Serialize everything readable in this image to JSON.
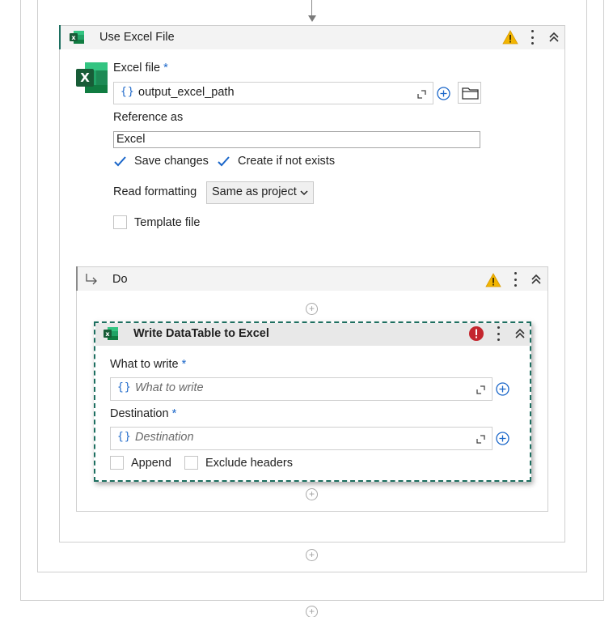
{
  "use_excel_file": {
    "title": "Use Excel File",
    "excel_file_label": "Excel file",
    "required_mark": "*",
    "excel_file_value": "output_excel_path",
    "braces": "{}",
    "reference_as_label": "Reference as",
    "reference_as_value": "Excel",
    "save_changes_label": "Save changes",
    "save_changes_checked": true,
    "create_if_not_exists_label": "Create if not exists",
    "create_if_not_exists_checked": true,
    "read_formatting_label": "Read formatting",
    "read_formatting_value": "Same as project",
    "template_file_label": "Template file",
    "template_file_checked": false
  },
  "do_block": {
    "title": "Do"
  },
  "write_datatable": {
    "title": "Write DataTable to Excel",
    "what_to_write_label": "What to write",
    "what_to_write_placeholder": "What to write",
    "destination_label": "Destination",
    "destination_placeholder": "Destination",
    "required_mark": "*",
    "braces": "{}",
    "append_label": "Append",
    "append_checked": false,
    "exclude_headers_label": "Exclude headers",
    "exclude_headers_checked": false
  },
  "colors": {
    "excel_green": "#1d7044",
    "accent_blue": "#1a66c9",
    "warning": "#f2b500",
    "error": "#c4262e",
    "selection": "#1d6f60"
  }
}
